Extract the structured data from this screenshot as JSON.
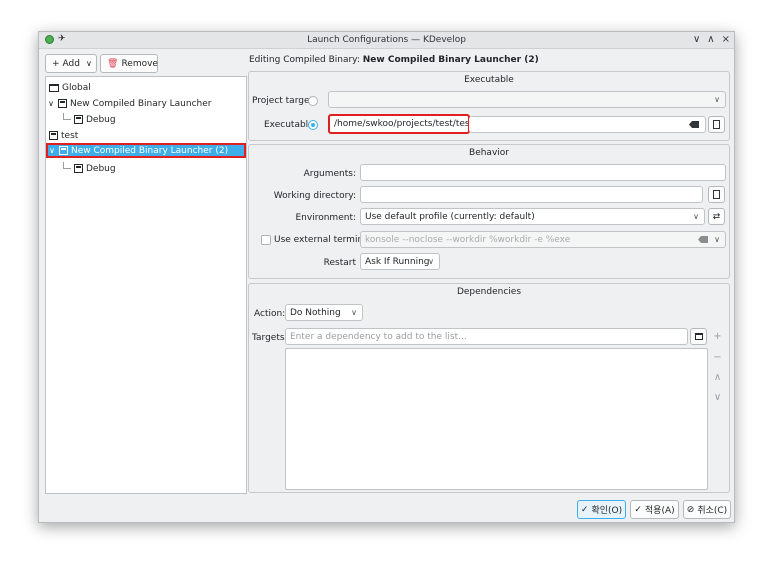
{
  "window": {
    "title": "Launch Configurations — KDevelop",
    "controls": [
      "∨",
      "∧",
      "×"
    ]
  },
  "toolbar": {
    "add_label": "Add",
    "remove_label": "Remove"
  },
  "tree": {
    "global_label": "Global",
    "launcher1_label": "New Compiled Binary Launcher",
    "debug1_label": "Debug",
    "test_label": "test",
    "launcher2_label": "New Compiled Binary Launcher (2)",
    "debug2_label": "Debug"
  },
  "editing": {
    "prefix": "Editing Compiled Binary:",
    "name": "New Compiled Binary Launcher (2)"
  },
  "executable_group": {
    "title": "Executable",
    "project_target_label": "Project target:",
    "executable_label": "Executable:",
    "executable_value": "/home/swkoo/projects/test/test.exe"
  },
  "behavior_group": {
    "title": "Behavior",
    "arguments_label": "Arguments:",
    "arguments_value": "",
    "working_dir_label": "Working directory:",
    "working_dir_value": "",
    "environment_label": "Environment:",
    "environment_value": "Use default profile (currently: default)",
    "external_terminal_label": "Use external terminal:",
    "external_terminal_value": "konsole --noclose --workdir %workdir -e %exe",
    "restart_label": "Restart",
    "restart_value": "Ask If Running"
  },
  "dependencies_group": {
    "title": "Dependencies",
    "action_label": "Action:",
    "action_value": "Do Nothing",
    "targets_label": "Targets:",
    "targets_placeholder": "Enter a dependency to add to the list..."
  },
  "buttons": {
    "ok_label": "확인(O)",
    "apply_label": "적용(A)",
    "cancel_label": "취소(C)"
  },
  "colors": {
    "selection": "#3daee9",
    "highlight_border": "#e02020"
  }
}
